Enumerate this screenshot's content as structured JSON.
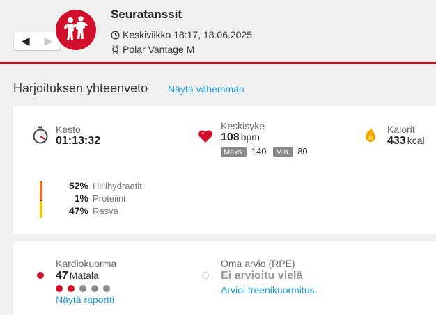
{
  "header": {
    "title": "Seuratanssit",
    "datetime": "Keskiviikko 18:17, 18.06.2025",
    "device": "Polar Vantage M",
    "prev_arrow": "◀",
    "next_arrow": "▶",
    "sport_icon": "dance-icon",
    "accent_color": "#d0102a"
  },
  "summary": {
    "title": "Harjoituksen yhteenveto",
    "toggle_link": "Näytä vähemmän"
  },
  "stats": {
    "duration": {
      "label": "Kesto",
      "value": "01:13:32",
      "icon": "stopwatch-icon"
    },
    "heart_rate": {
      "label": "Keskisyke",
      "value": "108",
      "unit": "bpm",
      "max_label": "Maks.",
      "max_value": "140",
      "min_label": "Min.",
      "min_value": "80",
      "icon": "heart-icon"
    },
    "calories": {
      "label": "Kalorit",
      "value": "433",
      "unit": "kcal",
      "icon": "flame-icon"
    }
  },
  "macros": [
    {
      "pct": "52%",
      "name": "Hiilihydraatit",
      "fraction": 0.52,
      "color": "#f26a1b"
    },
    {
      "pct": "1%",
      "name": "Proteiini",
      "fraction": 0.01,
      "color": "#d0102a"
    },
    {
      "pct": "47%",
      "name": "Rasva",
      "fraction": 0.47,
      "color": "#f5c400"
    }
  ],
  "load": {
    "cardio": {
      "label": "Kardiokuorma",
      "value": "47",
      "level": "Matala",
      "level_dots_filled": 2,
      "level_dots_total": 5,
      "report_link": "Näytä raportti"
    },
    "rpe": {
      "label": "Oma arvio (RPE)",
      "value": "Ei arvioitu vielä",
      "action_link": "Arvioi treenikuormitus"
    }
  }
}
